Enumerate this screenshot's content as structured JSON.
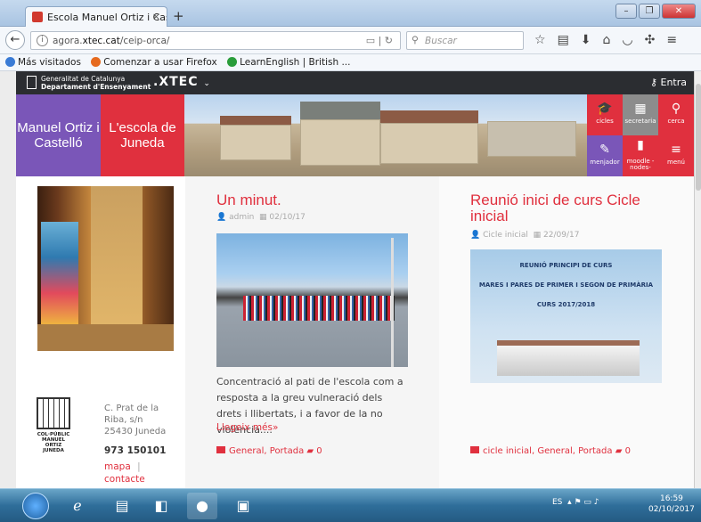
{
  "browser": {
    "tab_title": "Escola Manuel Ortiz i Castelló",
    "tab_close": "×",
    "new_tab": "+",
    "url_prefix": "agora.",
    "url_host": "xtec.cat",
    "url_path": "/ceip-orca/",
    "search_placeholder": "Buscar",
    "win_min": "–",
    "win_max": "❐",
    "win_close": "✕"
  },
  "bookmarks": [
    {
      "label": "Más visitados",
      "color": "#3a7bd5"
    },
    {
      "label": "Comenzar a usar Firefox",
      "color": "#e66a1e"
    },
    {
      "label": "LearnEnglish | British ...",
      "color": "#2a9d3a"
    }
  ],
  "site": {
    "gencat_line1": "Generalitat de Catalunya",
    "gencat_line2": "Departament d'Ensenyament",
    "xtec": ".XTEC",
    "entra": "Entra",
    "block1": "Manuel Ortiz i Castelló",
    "block2": "L'escola de Juneda",
    "tiles": [
      {
        "label": "cicles",
        "icon": "graduation-cap-icon",
        "color": "#e0303e"
      },
      {
        "label": "secretaria",
        "icon": "presentation-icon",
        "color": "#8c8c8c"
      },
      {
        "label": "cerca",
        "icon": "search-icon",
        "color": "#e0303e"
      },
      {
        "label": "menjador",
        "icon": "kitchen-icon",
        "color": "#7a56b8"
      },
      {
        "label": "moodle -nodes-",
        "icon": "book-icon",
        "color": "#e0303e"
      },
      {
        "label": "menú",
        "icon": "menu-icon",
        "color": "#e0303e"
      }
    ]
  },
  "sidebar": {
    "logo_text1": "COL·PÚBLIC",
    "logo_text2": "MANUEL ORTIZ",
    "logo_text3": "JUNEDA",
    "address1": "C. Prat de la",
    "address2": "Riba, s/n",
    "address3": "25430 Juneda",
    "phone": "973 150101",
    "map_link": "mapa",
    "sep": "|",
    "contact_link": "contacte"
  },
  "posts": [
    {
      "title": "Un minut.",
      "author": "admin",
      "date": "02/10/17",
      "excerpt": "Concentració al pati de l'escola com a resposta a la greu vulneració dels drets i llibertats, i a favor de la no violència....",
      "more": "Llegeix més»",
      "categories": "General, Portada",
      "comments": "0"
    },
    {
      "title": "Reunió inici de curs Cicle inicial",
      "author": "Cicle inicial",
      "date": "22/09/17",
      "poster_line1": "REUNIÓ PRINCIPI DE CURS",
      "poster_line2": "MARES I PARES DE PRIMER I SEGON DE PRIMÀRIA",
      "poster_line3": "CURS 2017/2018",
      "categories": "cicle inicial, General, Portada",
      "comments": "0"
    }
  ],
  "taskbar": {
    "tray_lang": "ES",
    "time": "16:59",
    "date": "02/10/2017"
  }
}
